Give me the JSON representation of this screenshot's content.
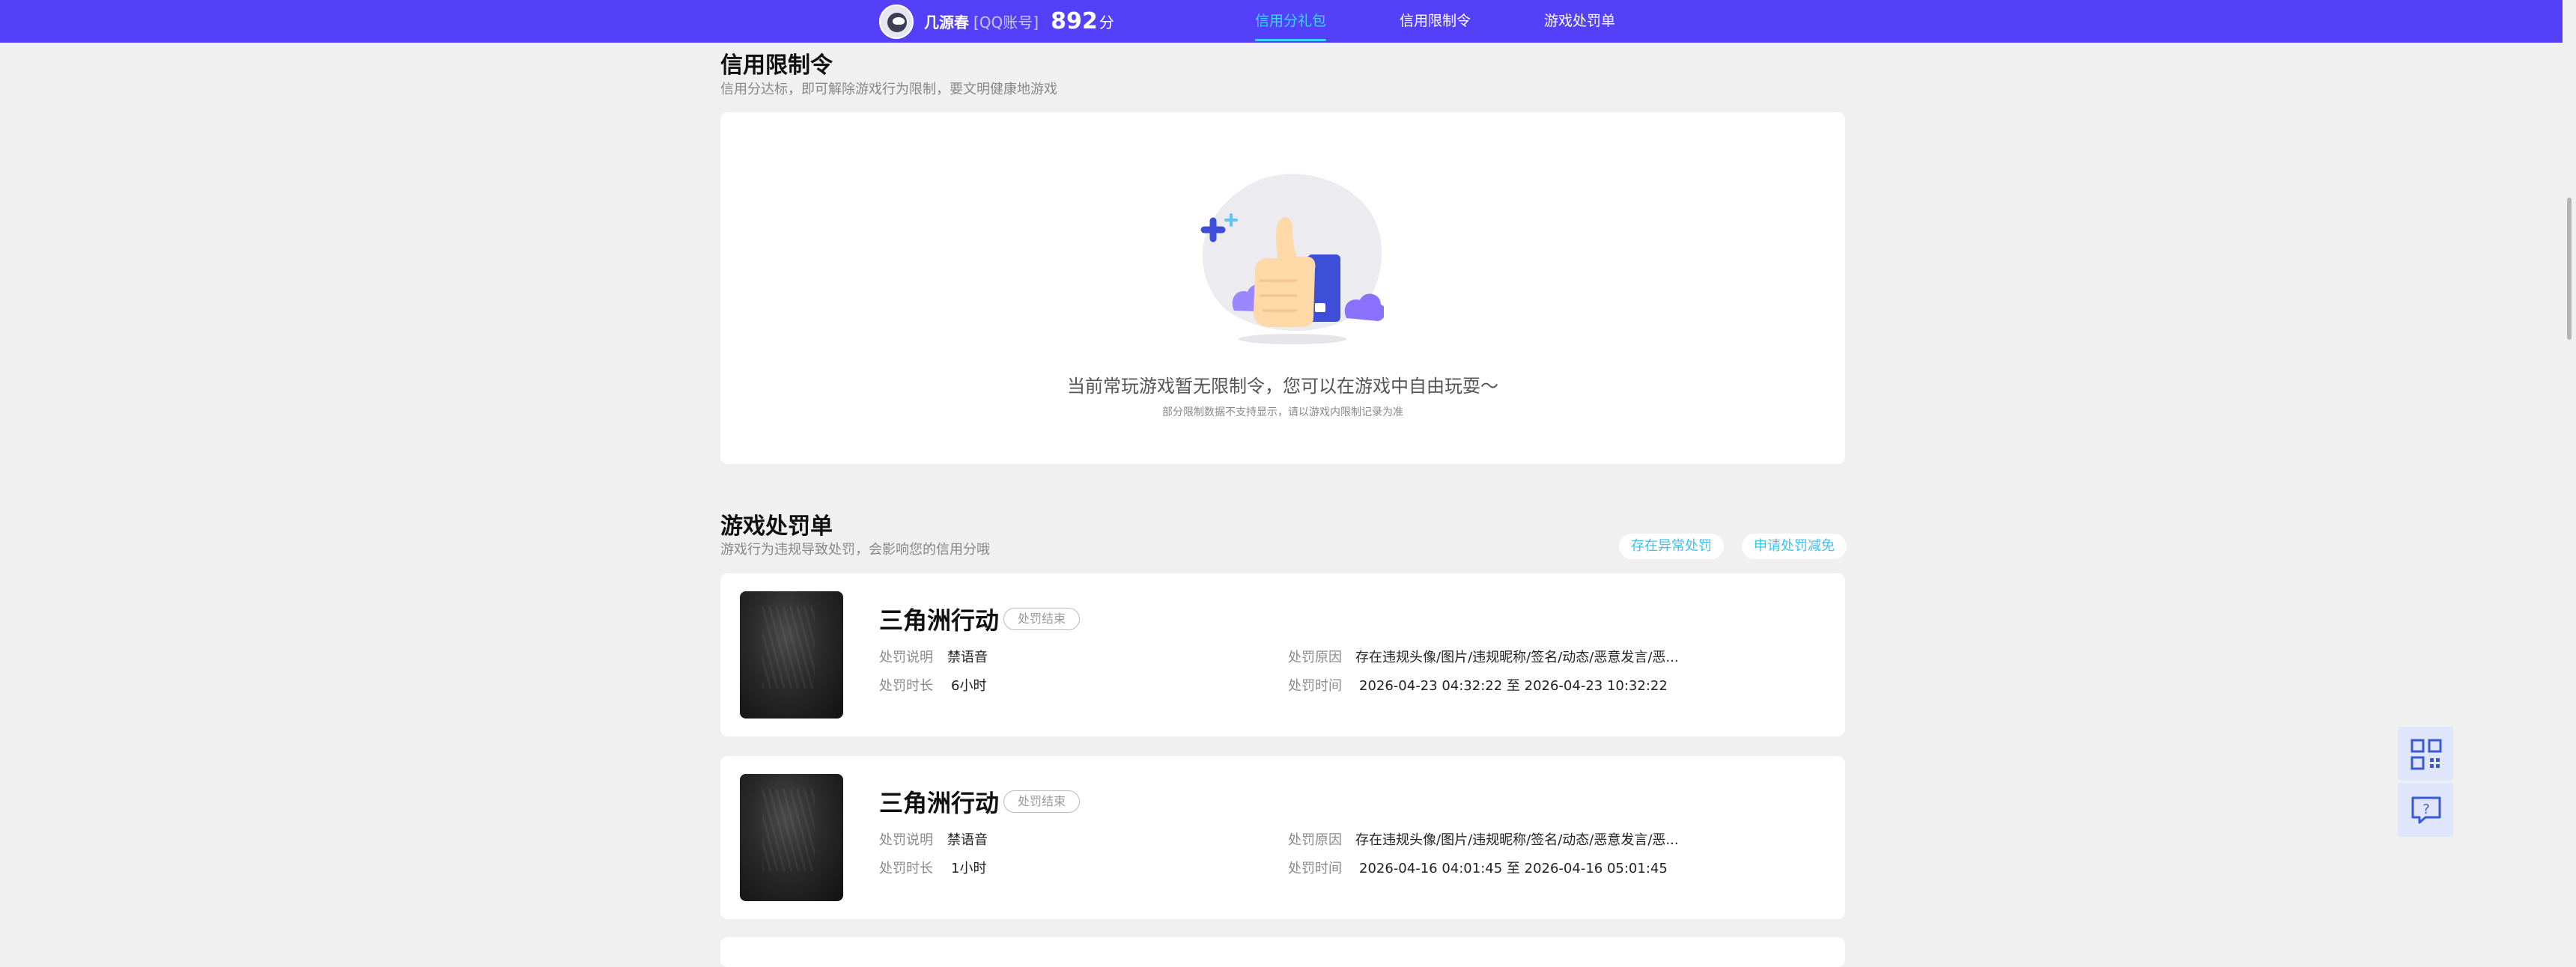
{
  "header": {
    "username": "几源春",
    "account_type": "[QQ账号]",
    "score": "892",
    "score_unit": "分",
    "tabs": [
      {
        "label": "信用分礼包",
        "active": true
      },
      {
        "label": "信用限制令",
        "active": false
      },
      {
        "label": "游戏处罚单",
        "active": false
      }
    ]
  },
  "restriction": {
    "title": "信用限制令",
    "subtitle": "信用分达标，即可解除游戏行为限制，要文明健康地游戏",
    "empty_message": "当前常玩游戏暂无限制令，您可以在游戏中自由玩耍～",
    "empty_note": "部分限制数据不支持显示，请以游戏内限制记录为准"
  },
  "penalty": {
    "title": "游戏处罚单",
    "subtitle": "游戏行为违规导致处罚，会影响您的信用分哦",
    "buttons": {
      "abnormal": "存在异常处罚",
      "appeal": "申请处罚减免"
    },
    "labels": {
      "description": "处罚说明",
      "duration": "处罚时长",
      "reason": "处罚原因",
      "time": "处罚时间"
    },
    "items": [
      {
        "game": "三角洲行动",
        "status": "处罚结束",
        "description": "禁语音",
        "duration": "6小时",
        "reason": "存在违规头像/图片/违规昵称/签名/动态/恶意发言/恶...",
        "time": "2026-04-23 04:32:22 至 2026-04-23 10:32:22"
      },
      {
        "game": "三角洲行动",
        "status": "处罚结束",
        "description": "禁语音",
        "duration": "1小时",
        "reason": "存在违规头像/图片/违规昵称/签名/动态/恶意发言/恶...",
        "time": "2026-04-16 04:01:45 至 2026-04-16 05:01:45"
      }
    ]
  },
  "colors": {
    "nav_bg": "#5340f8",
    "accent": "#3fd3ff",
    "page_bg": "#f0f0f0"
  },
  "icons": {
    "qr": "qr-code-icon",
    "help": "help-chat-icon",
    "illustration": "thumbs-up-illustration"
  }
}
